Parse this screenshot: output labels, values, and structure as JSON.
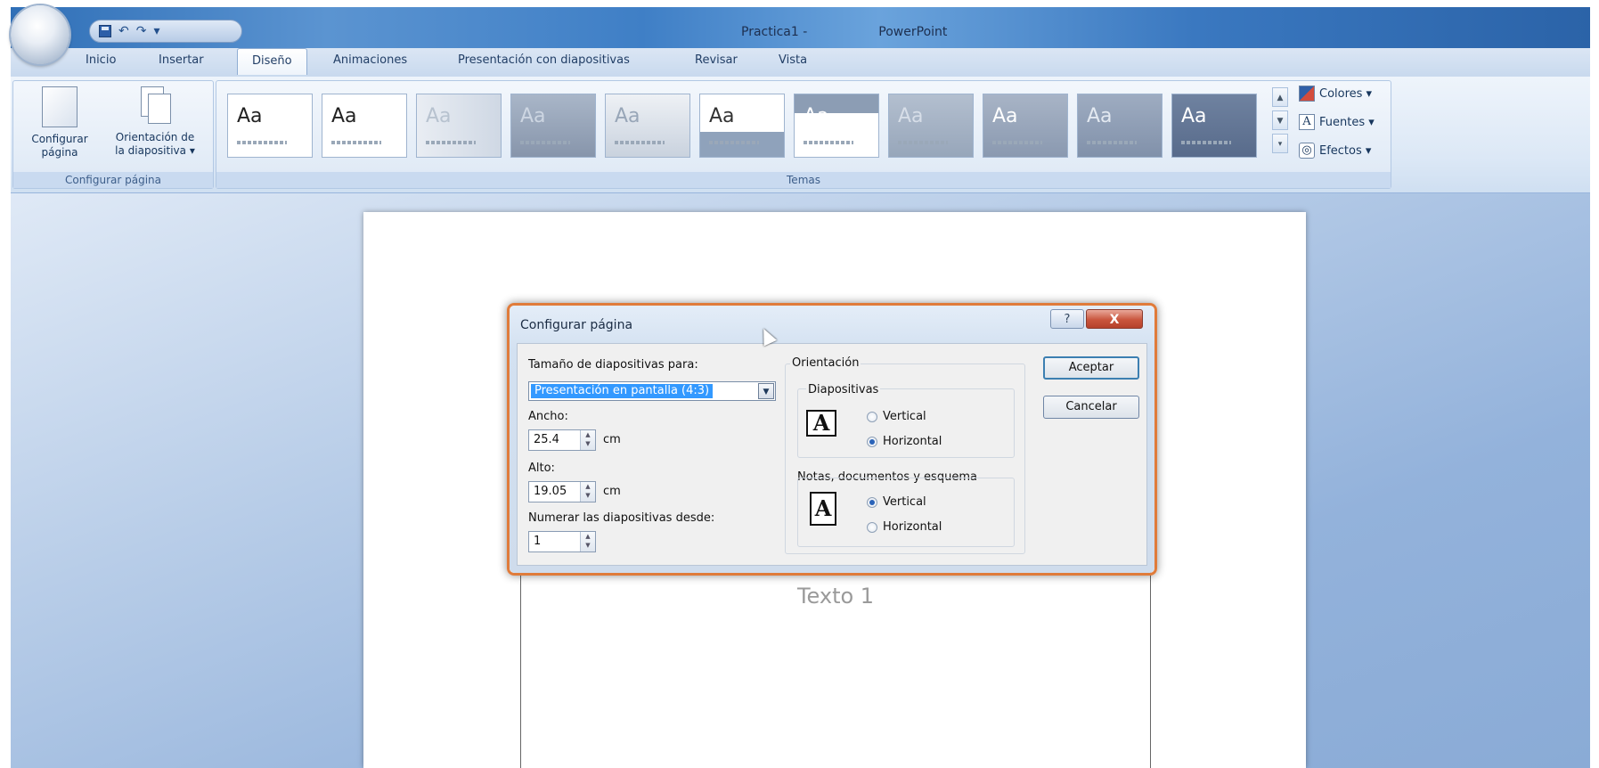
{
  "window": {
    "title": "Practica1 -",
    "app_name": "PowerPoint"
  },
  "tabs": [
    "Inicio",
    "Insertar",
    "Diseño",
    "Animaciones",
    "Presentación con diapositivas",
    "Revisar",
    "Vista"
  ],
  "active_tab": "Diseño",
  "ribbon": {
    "page_setup_group": {
      "label": "Configurar página",
      "page_setup_button": {
        "line1": "Configurar",
        "line2": "página"
      },
      "orientation_button": {
        "line1": "Orientación de",
        "line2": "la diapositiva ▾"
      }
    },
    "themes_group": {
      "label": "Temas",
      "theme_text": "Aa",
      "themes_count_label": "11"
    },
    "side": {
      "colors": "Colores ▾",
      "fonts": "Fuentes ▾",
      "effects": "Efectos ▾"
    }
  },
  "slide": {
    "text": "Texto 1"
  },
  "dialog": {
    "title": "Configurar página",
    "help": "?",
    "close": "X",
    "size_label": "Tamaño de diapositivas para:",
    "size_value": "Presentación en pantalla (4:3)",
    "width_label": "Ancho:",
    "width_value": "25.4",
    "height_label": "Alto:",
    "height_value": "19.05",
    "unit": "cm",
    "number_from_label": "Numerar las diapositivas desde:",
    "number_from_value": "1",
    "orientation_label": "Orientación",
    "slides_label": "Diapositivas",
    "notes_label": "Notas, documentos y esquema",
    "vertical": "Vertical",
    "horizontal": "Horizontal",
    "ok": "Aceptar",
    "cancel": "Cancelar"
  }
}
